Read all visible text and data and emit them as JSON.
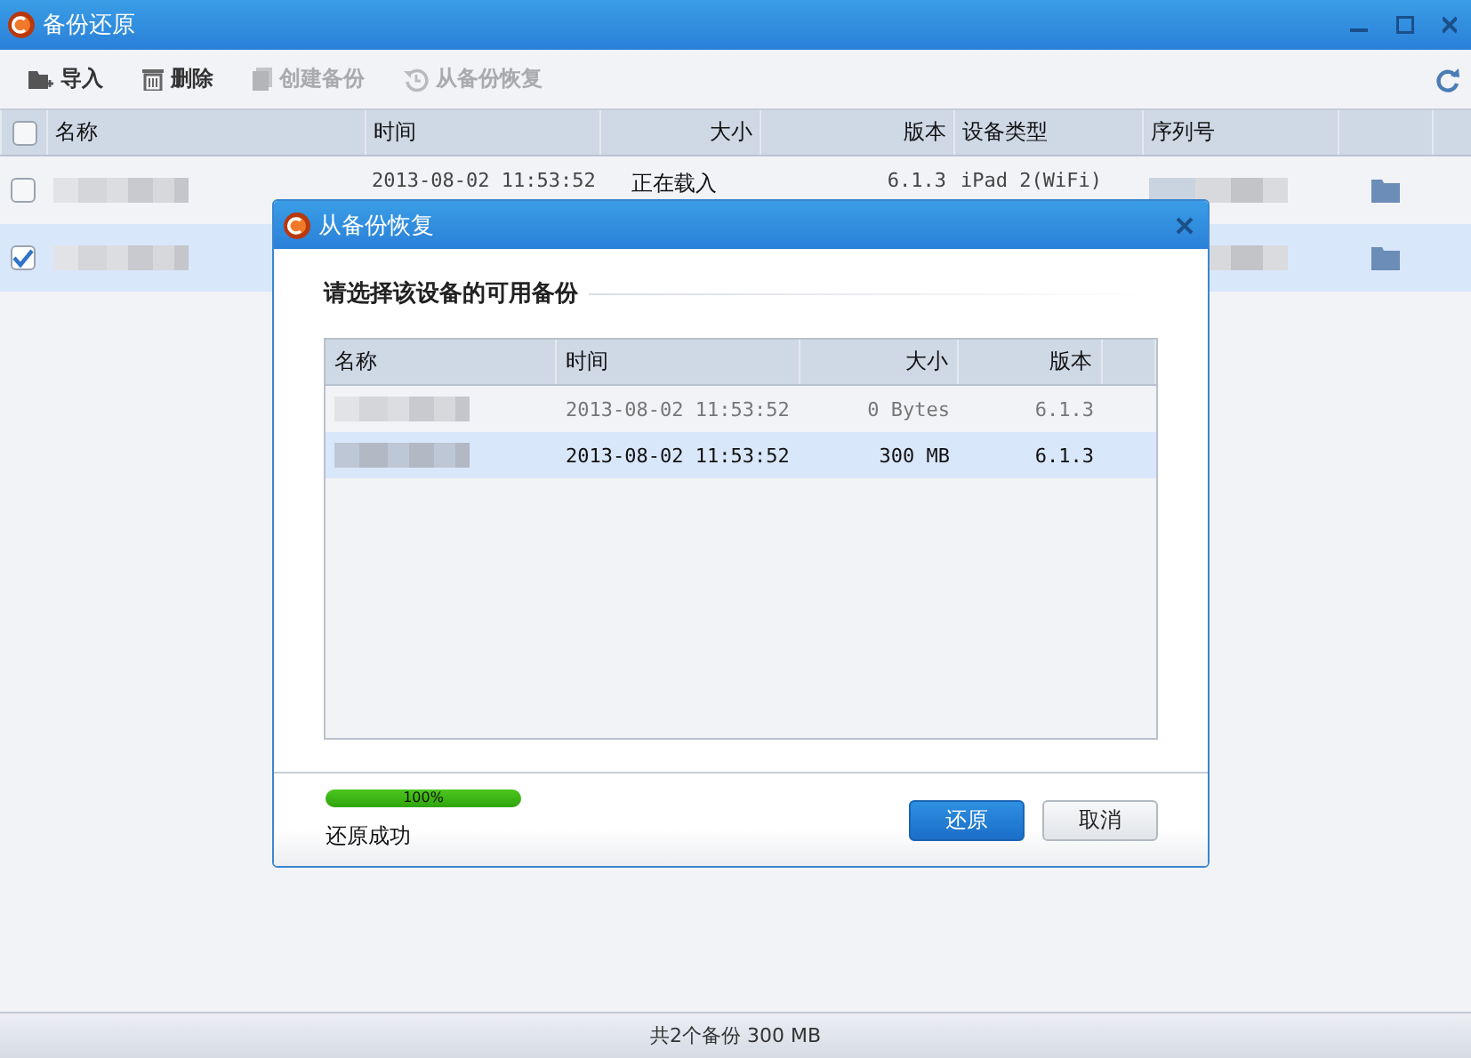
{
  "window": {
    "title": "备份还原"
  },
  "toolbar": [
    {
      "label": "导入",
      "kind": "import",
      "disabled": false
    },
    {
      "label": "删除",
      "kind": "delete",
      "disabled": false
    },
    {
      "label": "创建备份",
      "kind": "create",
      "disabled": true
    },
    {
      "label": "从备份恢复",
      "kind": "restore",
      "disabled": true
    }
  ],
  "table": {
    "all_checked": false,
    "columns": [
      "名称",
      "时间",
      "大小",
      "版本",
      "设备类型",
      "序列号"
    ],
    "rows": [
      {
        "checked": false,
        "selected": false,
        "time": "2013-08-02 11:53:52",
        "size": "正在载入",
        "version": "6.1.3",
        "device_type": "iPad 2(WiFi)"
      },
      {
        "checked": true,
        "selected": true
      }
    ]
  },
  "dialog": {
    "title": "从备份恢复",
    "heading": "请选择该设备的可用备份",
    "columns": [
      "名称",
      "时间",
      "大小",
      "版本"
    ],
    "rows": [
      {
        "time": "2013-08-02 11:53:52",
        "size": "0 Bytes",
        "version": "6.1.3",
        "selected": false,
        "disabled": true
      },
      {
        "time": "2013-08-02 11:53:52",
        "size": "300 MB",
        "version": "6.1.3",
        "selected": true,
        "disabled": false
      }
    ],
    "progress": {
      "level": 1,
      "label": "100%"
    },
    "status": "还原成功",
    "buttons": [
      {
        "label": "还原",
        "kind": "primary"
      },
      {
        "label": "取消",
        "kind": "secondary"
      }
    ]
  },
  "status_bar": "共2个备份 300 MB"
}
